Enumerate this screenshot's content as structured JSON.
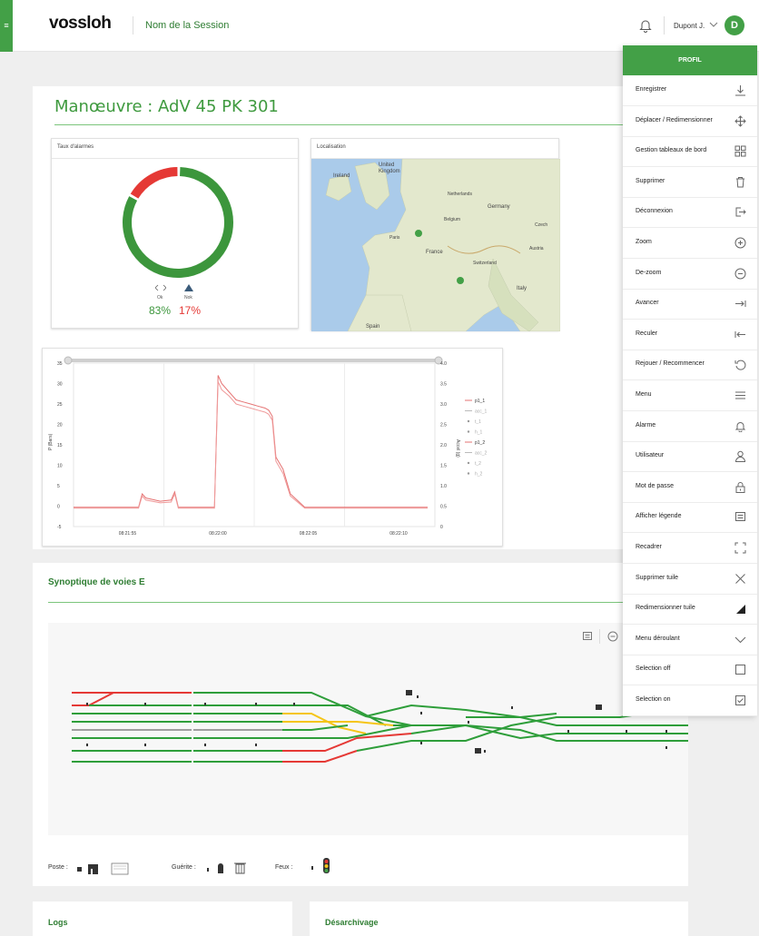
{
  "app": {
    "menu_glyph": "≡",
    "logo": "vossloh",
    "session_name": "Nom de la Session"
  },
  "user": {
    "name": "Dupont J.",
    "avatar_letter": "D"
  },
  "page_title": "Manœuvre : AdV 45 PK 301",
  "alarm_panel": {
    "title": "Taux d'alarmes",
    "ok_label": "Ok",
    "nok_label": "Nok",
    "ok_value": "83%",
    "nok_value": "17%",
    "ok_fraction": 0.83,
    "colors": {
      "ok": "#3c963c",
      "nok": "#e53935"
    }
  },
  "map_panel": {
    "title": "Localisation",
    "labels": [
      "United",
      "Kingdom",
      "Ireland",
      "Netherlands",
      "Germany",
      "Belgium",
      "France",
      "Switzerland",
      "Italy",
      "Austria",
      "Czech",
      "Paris",
      "Spain"
    ]
  },
  "chart_data": {
    "type": "line",
    "x_ticks": [
      "08:21:55",
      "08:22:00",
      "08:22:05",
      "08:22:10"
    ],
    "y_left": {
      "label": "P (Bars)",
      "ticks": [
        35,
        30,
        25,
        20,
        15,
        10,
        5,
        0,
        -5
      ],
      "lim": [
        -5,
        35
      ]
    },
    "y_right": {
      "label": "Accel (g)",
      "ticks": [
        "4.0",
        "3.5",
        "3.0",
        "2.5",
        "2.0",
        "1.5",
        "1.0",
        "0.5",
        "0"
      ],
      "lim": [
        0,
        4.0
      ]
    },
    "legend": [
      "p1_1",
      "acc_1",
      "t_1",
      "h_1",
      "p1_2",
      "acc_2",
      "t_2",
      "h_2"
    ],
    "x": [
      0,
      9,
      10,
      18,
      19,
      20,
      24,
      27,
      28,
      29,
      38,
      39,
      40,
      41,
      43,
      45,
      47,
      49,
      51,
      53,
      54,
      55,
      56,
      58,
      60,
      64,
      68,
      70,
      72,
      74,
      78,
      90,
      98
    ],
    "series": [
      {
        "name": "p1_1",
        "values": [
          -0.3,
          -0.3,
          -0.3,
          -0.3,
          3,
          2,
          1.2,
          1.5,
          3.5,
          -0.3,
          -0.3,
          -0.3,
          32,
          30,
          28,
          26,
          25.5,
          25,
          24.5,
          24,
          23.5,
          22,
          12,
          9,
          3,
          -0.3,
          -0.3,
          -0.3,
          -0.3,
          -0.3,
          -0.3,
          -0.3,
          -0.3
        ]
      },
      {
        "name": "p1_2",
        "values": [
          -0.5,
          -0.5,
          -0.5,
          -0.5,
          2.5,
          1.5,
          0.8,
          1,
          3,
          -0.5,
          -0.5,
          -0.5,
          30.5,
          28.5,
          27,
          25,
          24.5,
          24,
          23.5,
          23,
          22.5,
          21,
          11,
          8,
          2.5,
          -0.5,
          -0.5,
          -0.5,
          -0.5,
          -0.5,
          -0.5,
          -0.5,
          -0.5
        ]
      }
    ]
  },
  "synoptic": {
    "title": "Synoptique de voies E",
    "legend": {
      "poste": "Poste :",
      "guerite": "Guérite :",
      "feux": "Feux :"
    },
    "track_colors": {
      "free": "#2e9e3a",
      "occupied": "#e53935",
      "reserved": "#f5c518",
      "disabled": "#9e9e9e"
    }
  },
  "bottom": {
    "logs": "Logs",
    "desarchivage": "Désarchivage"
  },
  "profile": {
    "title": "PROFIL",
    "items": [
      {
        "label": "Enregistrer",
        "icon": "download-icon"
      },
      {
        "label": "Déplacer / Redimensionner",
        "icon": "move-icon"
      },
      {
        "label": "Gestion tableaux de bord",
        "icon": "dashboard-icon"
      },
      {
        "label": "Supprimer",
        "icon": "trash-icon"
      },
      {
        "label": "Déconnexion",
        "icon": "logout-icon"
      },
      {
        "label": "Zoom",
        "icon": "zoom-in-icon"
      },
      {
        "label": "De-zoom",
        "icon": "zoom-out-icon"
      },
      {
        "label": "Avancer",
        "icon": "forward-icon"
      },
      {
        "label": "Reculer",
        "icon": "backward-icon"
      },
      {
        "label": "Rejouer / Recommencer",
        "icon": "replay-icon"
      },
      {
        "label": "Menu",
        "icon": "menu-icon"
      },
      {
        "label": "Alarme",
        "icon": "bell-icon"
      },
      {
        "label": "Utilisateur",
        "icon": "user-icon"
      },
      {
        "label": "Mot de passe",
        "icon": "lock-icon"
      },
      {
        "label": "Afficher légende",
        "icon": "legend-icon"
      },
      {
        "label": "Recadrer",
        "icon": "crop-icon"
      },
      {
        "label": "Supprimer tuile",
        "icon": "close-icon"
      },
      {
        "label": "Redimensionner tuile",
        "icon": "resize-icon"
      },
      {
        "label": "Menu déroulant",
        "icon": "chevron-down-icon"
      },
      {
        "label": "Selection off",
        "icon": "checkbox-off-icon"
      },
      {
        "label": "Selection on",
        "icon": "checkbox-on-icon"
      }
    ]
  }
}
